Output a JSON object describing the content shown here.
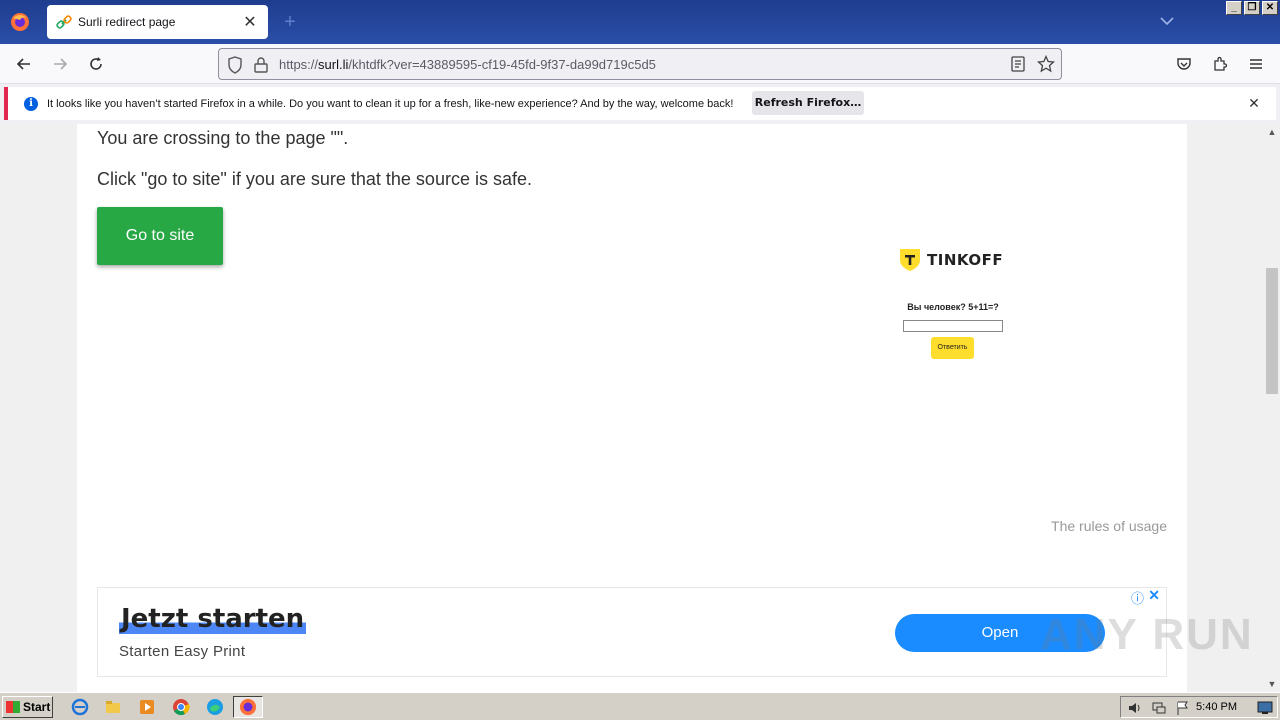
{
  "browser": {
    "tab_title": "Surli redirect page",
    "url_prefix": "https://",
    "url_domain": "surl.li",
    "url_rest": "/khtdfk?ver=43889595-cf19-45fd-9f37-da99d719c5d5",
    "notification": {
      "message": "It looks like you haven’t started Firefox in a while. Do you want to clean it up for a fresh, like-new experience? And by the way, welcome back!",
      "button": "Refresh Firefox…"
    }
  },
  "page": {
    "crossing_text": "You are crossing to the page \"\".",
    "click_text": "Click \"go to site\" if you are sure that the source is safe.",
    "go_button": "Go to site",
    "tinkoff": {
      "brand": "TINKOFF",
      "question": "Вы человек? 5+11=?",
      "answer_button": "Ответить"
    },
    "rules_link": "The rules of usage",
    "ad": {
      "headline": "Jetzt starten",
      "subtext": "Starten Easy Print",
      "button": "Open"
    }
  },
  "watermark": "ANY RUN",
  "taskbar": {
    "start": "Start",
    "clock": "5:40 PM"
  },
  "colors": {
    "go_button": "#28a745",
    "ad_button": "#1a8cff",
    "tinkoff_yellow": "#ffdd2d",
    "notification_accent": "#e22850"
  }
}
